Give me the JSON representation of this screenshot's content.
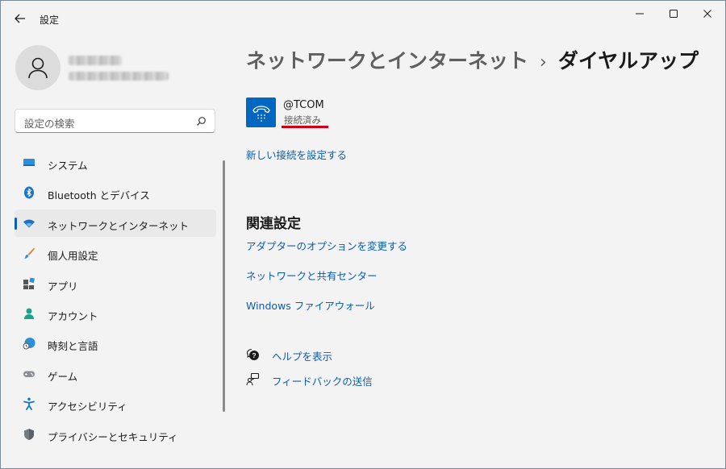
{
  "window": {
    "title": "設定"
  },
  "search": {
    "placeholder": "設定の検索"
  },
  "nav": {
    "items": [
      {
        "label": "システム",
        "icon": "system-icon"
      },
      {
        "label": "Bluetooth とデバイス",
        "icon": "bluetooth-icon"
      },
      {
        "label": "ネットワークとインターネット",
        "icon": "wifi-icon",
        "active": true
      },
      {
        "label": "個人用設定",
        "icon": "brush-icon"
      },
      {
        "label": "アプリ",
        "icon": "apps-icon"
      },
      {
        "label": "アカウント",
        "icon": "account-icon"
      },
      {
        "label": "時刻と言語",
        "icon": "globe-clock-icon"
      },
      {
        "label": "ゲーム",
        "icon": "gamepad-icon"
      },
      {
        "label": "アクセシビリティ",
        "icon": "accessibility-icon"
      },
      {
        "label": "プライバシーとセキュリティ",
        "icon": "shield-icon"
      }
    ]
  },
  "main": {
    "breadcrumb_parent": "ネットワークとインターネット",
    "breadcrumb_separator": "›",
    "breadcrumb_current": "ダイヤルアップ",
    "connection": {
      "name": "@TCOM",
      "status": "接続済み",
      "icon": "dialup-phone-icon"
    },
    "new_connection_link": "新しい接続を設定する",
    "related_title": "関連設定",
    "related_links": [
      "アダプターのオプションを変更する",
      "ネットワークと共有センター",
      "Windows ファイアウォール"
    ],
    "help_link": "ヘルプを表示",
    "feedback_link": "フィードバックの送信"
  },
  "colors": {
    "accent": "#005fb8",
    "link": "#0b5cad",
    "underline_highlight": "#d00014",
    "connection_tile": "#0067c0"
  }
}
